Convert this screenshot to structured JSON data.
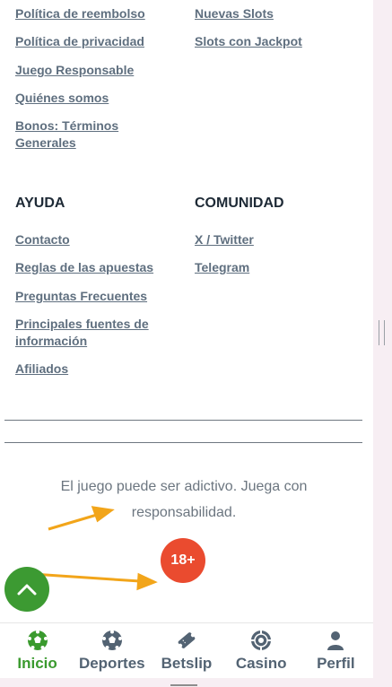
{
  "footer": {
    "left_links_top": [
      "Política de reembolso",
      "Política de privacidad",
      "Juego Responsable",
      "Quiénes somos",
      "Bonos: Términos Generales"
    ],
    "right_links_top": [
      "Nuevas Slots",
      "Slots con Jackpot"
    ],
    "help": {
      "heading": "AYUDA",
      "links": [
        "Contacto",
        "Reglas de las apuestas",
        "Preguntas Frecuentes",
        "Principales fuentes de información",
        "Afiliados"
      ]
    },
    "community": {
      "heading": "COMUNIDAD",
      "links": [
        "X / Twitter",
        "Telegram"
      ]
    }
  },
  "notice": "El juego puede ser adictivo. Juega con responsabilidad.",
  "age_badge": "18+",
  "bottom_nav": {
    "items": [
      {
        "label": "Inicio",
        "icon": "soccer-ball-icon",
        "active": true
      },
      {
        "label": "Deportes",
        "icon": "sports-ball-icon",
        "active": false
      },
      {
        "label": "Betslip",
        "icon": "ticket-icon",
        "active": false
      },
      {
        "label": "Casino",
        "icon": "casino-chip-icon",
        "active": false
      },
      {
        "label": "Perfil",
        "icon": "user-icon",
        "active": false
      }
    ]
  },
  "colors": {
    "link": "#5f6f7f",
    "accent_green": "#3c9a32",
    "badge_red": "#ea4b2f",
    "annotation_arrow": "#f2a51a"
  }
}
